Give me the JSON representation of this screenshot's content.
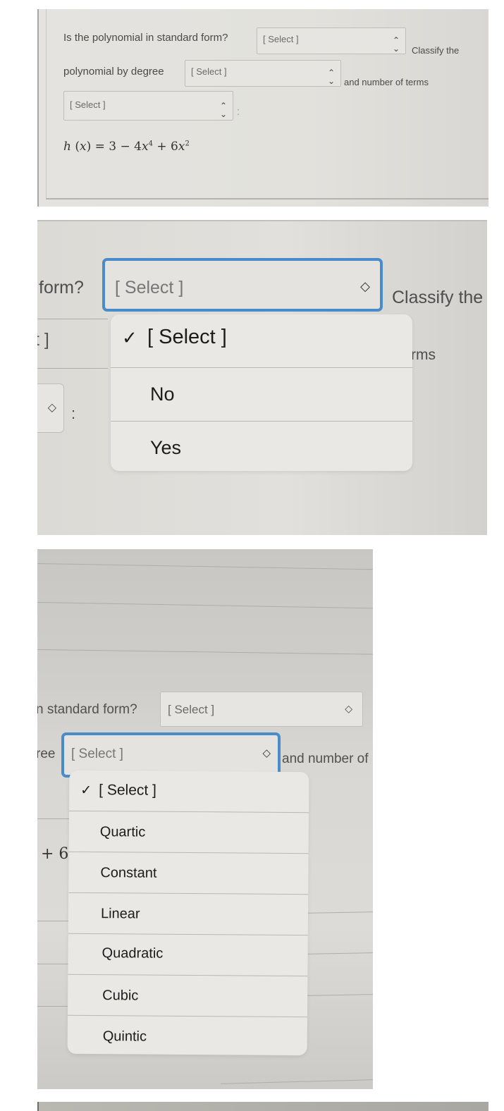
{
  "question": {
    "part1": "Is the polynomial in standard form?",
    "part2": "Classify the",
    "part3": "polynomial by degree",
    "part4": "and number of terms",
    "colon": ":",
    "equation": {
      "lhs": "h",
      "var": "x",
      "rhs_const": "3",
      "term2_coef": "4",
      "term2_exp": "4",
      "term3_coef": "6",
      "term3_exp": "2"
    }
  },
  "selects": {
    "standard_form": {
      "value": "[ Select ]"
    },
    "degree": {
      "value": "[ Select ]"
    },
    "terms": {
      "value": "[ Select ]"
    }
  },
  "panel2": {
    "label_left": "form?",
    "label_right": "Classify the",
    "clipped_select_text": "t ]",
    "clipped_terms_text": "rms",
    "colon": ":",
    "focused_select_value": "[ Select ]",
    "dropdown_options": [
      {
        "label": "[ Select ]",
        "checked": true
      },
      {
        "label": "No",
        "checked": false
      },
      {
        "label": "Yes",
        "checked": false
      }
    ]
  },
  "panel3": {
    "label_standard_form": "n standard form?",
    "standard_form_value": "[ Select ]",
    "label_degree": "ree",
    "focused_select_value": "[ Select ]",
    "label_terms": "and number of",
    "clipped_equation": "+ 6",
    "dropdown_options": [
      {
        "label": "[ Select ]",
        "checked": true
      },
      {
        "label": "Quartic",
        "checked": false
      },
      {
        "label": "Constant",
        "checked": false
      },
      {
        "label": "Linear",
        "checked": false
      },
      {
        "label": "Quadratic",
        "checked": false
      },
      {
        "label": "Cubic",
        "checked": false
      },
      {
        "label": "Quintic",
        "checked": false
      }
    ]
  },
  "icons": {
    "chevron": "⌃⌄",
    "check": "✓"
  },
  "colors": {
    "focus_border": "#4a8cc9",
    "menu_bg": "#e9e8e4",
    "panel_bg": "#e2e1dc"
  }
}
